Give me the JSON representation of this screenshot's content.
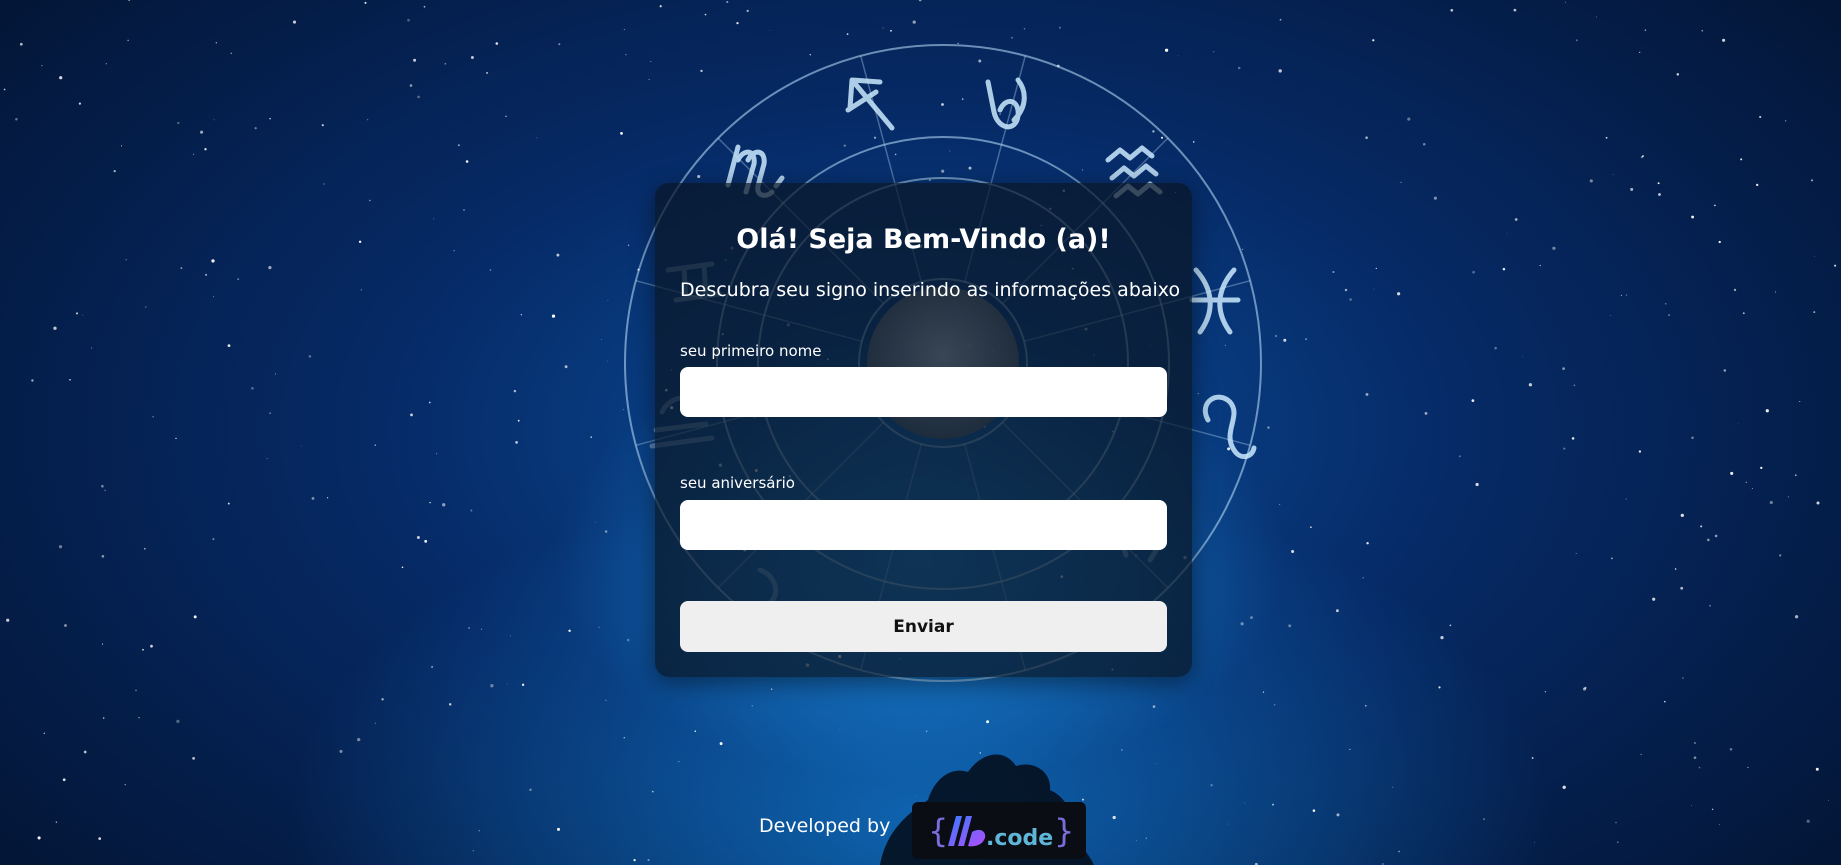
{
  "form": {
    "title": "Olá! Seja Bem-Vindo (a)!",
    "subtitle": "Descubra seu signo inserindo as informações abaixo",
    "name_label": "seu primeiro nome",
    "name_value": "",
    "birthday_label": "seu aniversário",
    "birthday_value": "",
    "submit_label": "Enviar"
  },
  "footer": {
    "developed_by": "Developed by",
    "logo_text": ".code",
    "logo_brace_left": "{",
    "logo_brace_right": "}"
  },
  "zodiac_icons": [
    "scorpio-icon",
    "sagittarius-icon",
    "capricorn-icon",
    "aquarius-icon",
    "pisces-icon",
    "aries-icon",
    "taurus-icon",
    "gemini-icon",
    "cancer-icon",
    "leo-icon",
    "virgo-icon",
    "libra-icon"
  ],
  "colors": {
    "background_deep": "#031535",
    "background_glow": "#1a8ee0",
    "wheel_line": "#bfe3ff",
    "card_bg": "rgba(10,22,38,0.72)",
    "button_bg": "#efefef",
    "logo_accent": "#8a4dff"
  }
}
